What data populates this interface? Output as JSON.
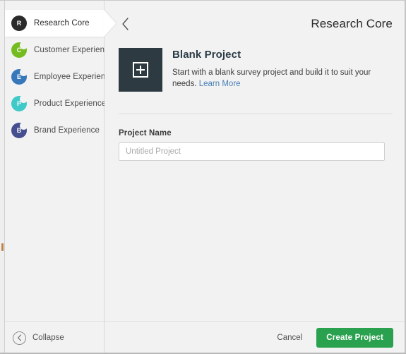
{
  "window": {
    "title": "Research Core"
  },
  "sidebar": {
    "items": [
      {
        "label": "Research Core",
        "icon": "research-core-icon",
        "glyph": "R",
        "color": "#2b2b2b",
        "selected": true
      },
      {
        "label": "Customer Experience",
        "icon": "customer-experience-icon",
        "glyph": "C",
        "color": "#74bc1f",
        "selected": false
      },
      {
        "label": "Employee Experience",
        "icon": "employee-experience-icon",
        "glyph": "E",
        "color": "#3778bb",
        "selected": false
      },
      {
        "label": "Product Experience",
        "icon": "product-experience-icon",
        "glyph": "P",
        "color": "#3fc9c9",
        "selected": false
      },
      {
        "label": "Brand Experience",
        "icon": "brand-experience-icon",
        "glyph": "B",
        "color": "#454municipal",
        "selected": false
      }
    ],
    "collapse": {
      "label": "Collapse",
      "icon": "chevron-left-circle-icon"
    }
  },
  "header": {
    "back_icon": "chevron-left-icon",
    "title": "Research Core"
  },
  "project_card": {
    "thumb_icon": "plus-square-icon",
    "title": "Blank Project",
    "description": "Start with a blank survey project and build it to suit your needs.",
    "link_label": "Learn More"
  },
  "form": {
    "project_name_label": "Project Name",
    "project_name_value": "",
    "project_name_placeholder": "Untitled Project"
  },
  "footer": {
    "cancel_label": "Cancel",
    "create_label": "Create Project",
    "create_color": "#2aa14e"
  }
}
